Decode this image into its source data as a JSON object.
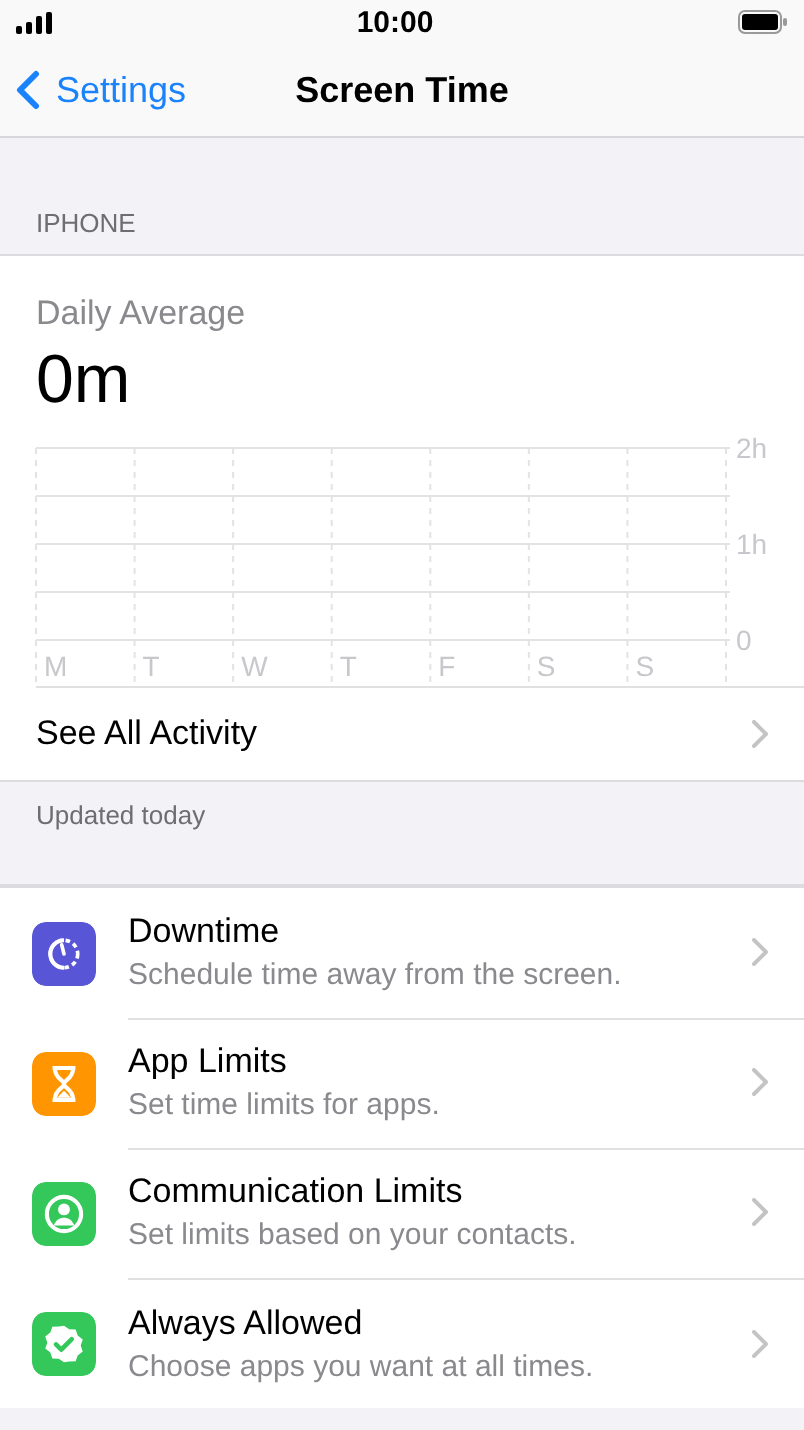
{
  "status_bar": {
    "time": "10:00"
  },
  "nav": {
    "back": "Settings",
    "title": "Screen Time"
  },
  "section_header": "IPHONE",
  "usage": {
    "label": "Daily Average",
    "value": "0m",
    "chart_data": {
      "type": "bar",
      "categories": [
        "M",
        "T",
        "W",
        "T",
        "F",
        "S",
        "S"
      ],
      "values": [
        null,
        null,
        null,
        null,
        null,
        null,
        null
      ],
      "ylim": [
        0,
        2
      ],
      "yticks": [
        {
          "value": 0,
          "label": "0"
        },
        {
          "value": 1,
          "label": "1h"
        },
        {
          "value": 2,
          "label": "2h"
        }
      ]
    },
    "link": "See All Activity"
  },
  "footer": "Updated today",
  "features": [
    {
      "title": "Downtime",
      "subtitle": "Schedule time away from the screen.",
      "color": "#5856d6"
    },
    {
      "title": "App Limits",
      "subtitle": "Set time limits for apps.",
      "color": "#ff9500"
    },
    {
      "title": "Communication Limits",
      "subtitle": "Set limits based on your contacts.",
      "color": "#34c759"
    },
    {
      "title": "Always Allowed",
      "subtitle": "Choose apps you want at all times.",
      "color": "#34c759"
    }
  ]
}
